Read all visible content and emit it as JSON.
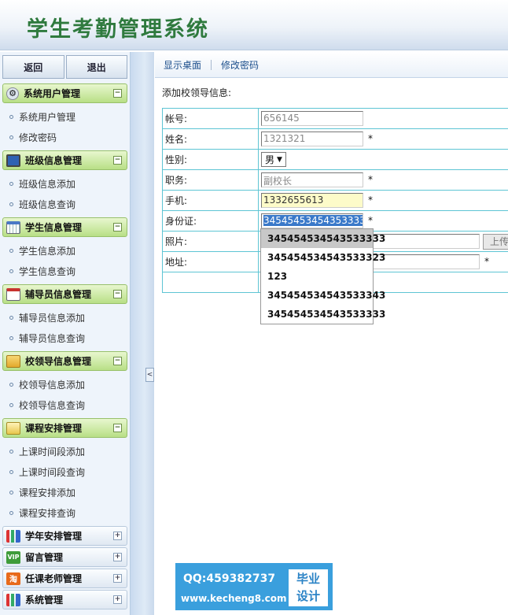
{
  "header": {
    "title": "学生考勤管理系统"
  },
  "sidebar": {
    "buttons": {
      "back": "返回",
      "exit": "退出"
    },
    "sections": [
      {
        "title": "系统用户管理",
        "icon": "gear-icon",
        "expanded": true,
        "items": [
          "系统用户管理",
          "修改密码"
        ]
      },
      {
        "title": "班级信息管理",
        "icon": "monitor-icon",
        "expanded": true,
        "items": [
          "班级信息添加",
          "班级信息查询"
        ]
      },
      {
        "title": "学生信息管理",
        "icon": "calendar-icon",
        "expanded": true,
        "items": [
          "学生信息添加",
          "学生信息查询"
        ]
      },
      {
        "title": "辅导员信息管理",
        "icon": "calendar-red-icon",
        "expanded": true,
        "items": [
          "辅导员信息添加",
          "辅导员信息查询"
        ]
      },
      {
        "title": "校领导信息管理",
        "icon": "folder-icon",
        "expanded": true,
        "items": [
          "校领导信息添加",
          "校领导信息查询"
        ]
      },
      {
        "title": "课程安排管理",
        "icon": "notepad-icon",
        "expanded": true,
        "items": [
          "上课时间段添加",
          "上课时间段查询",
          "课程安排添加",
          "课程安排查询"
        ]
      },
      {
        "title": "学年安排管理",
        "icon": "chart-icon",
        "expanded": false,
        "items": []
      },
      {
        "title": "留言管理",
        "icon": "vip-icon",
        "expanded": false,
        "items": []
      },
      {
        "title": "任课老师管理",
        "icon": "taobao-icon",
        "expanded": false,
        "items": []
      },
      {
        "title": "系统管理",
        "icon": "chart-icon",
        "expanded": false,
        "items": []
      }
    ],
    "expand_symbol": "−",
    "collapse_symbol": "+",
    "splitter_symbol": "<"
  },
  "topnav": {
    "links": [
      "显示桌面",
      "修改密码"
    ]
  },
  "form": {
    "caption": "添加校领导信息:",
    "fields": {
      "account": {
        "label": "帐号:",
        "value": "656145"
      },
      "name": {
        "label": "姓名:",
        "value": "1321321",
        "required": "*"
      },
      "gender": {
        "label": "性别:",
        "value": "男",
        "arrow": "▼"
      },
      "position": {
        "label": "职务:",
        "value": "副校长",
        "required": "*"
      },
      "phone": {
        "label": "手机:",
        "value": "1332655613",
        "required": "*"
      },
      "idcard": {
        "label": "身份证:",
        "value": "345454534543533333",
        "required": "*"
      },
      "photo": {
        "label": "照片:",
        "upload": "上传"
      },
      "address": {
        "label": "地址:",
        "required": "*"
      }
    }
  },
  "autocomplete": [
    "345454534543533333",
    "345454534543533323",
    "123",
    "345454534543533343",
    "345454534543533333"
  ],
  "watermark": {
    "qq": "QQ:459382737",
    "site": "www.kecheng8.com",
    "badge_line1": "毕业",
    "badge_line2": "设计"
  }
}
